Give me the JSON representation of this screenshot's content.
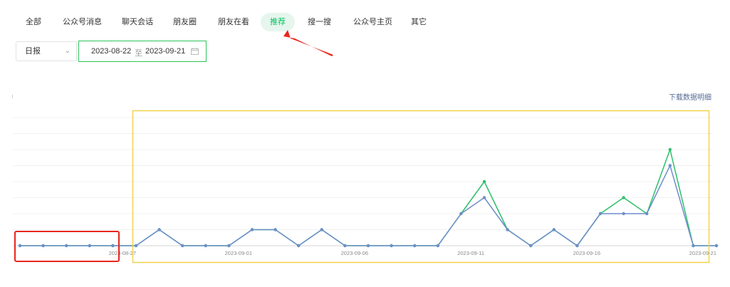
{
  "tabs": [
    {
      "label": "全部",
      "active": false
    },
    {
      "label": "公众号消息",
      "active": false
    },
    {
      "label": "聊天会话",
      "active": false
    },
    {
      "label": "朋友圈",
      "active": false
    },
    {
      "label": "朋友在看",
      "active": false
    },
    {
      "label": "推荐",
      "active": true
    },
    {
      "label": "搜一搜",
      "active": false
    },
    {
      "label": "公众号主页",
      "active": false
    },
    {
      "label": "其它",
      "active": false
    }
  ],
  "filters": {
    "frequency": "日报",
    "start_date": "2023-08-22",
    "separator": "至",
    "end_date": "2023-09-21",
    "calendar_icon": "calendar-icon",
    "dropdown_icon": "chevron-down-icon"
  },
  "download_label": "下载数据明细",
  "colors": {
    "accent": "#07c160",
    "series_green": "#2bc06c",
    "series_blue": "#6f8ecb",
    "highlight_yellow": "#f2d24c",
    "highlight_red": "#e8261d",
    "link": "#576b95"
  },
  "chart_data": {
    "type": "line",
    "x_tick_labels": [
      "2023-08-27",
      "2023-09-01",
      "2023-09-06",
      "2023-09-11",
      "2023-09-16",
      "2023-09-21"
    ],
    "x": [
      "2023-08-22",
      "2023-08-23",
      "2023-08-24",
      "2023-08-25",
      "2023-08-26",
      "2023-08-27",
      "2023-08-28",
      "2023-08-29",
      "2023-08-30",
      "2023-08-31",
      "2023-09-01",
      "2023-09-02",
      "2023-09-03",
      "2023-09-04",
      "2023-09-05",
      "2023-09-06",
      "2023-09-07",
      "2023-09-08",
      "2023-09-09",
      "2023-09-10",
      "2023-09-11",
      "2023-09-12",
      "2023-09-13",
      "2023-09-14",
      "2023-09-15",
      "2023-09-16",
      "2023-09-17",
      "2023-09-18",
      "2023-09-19",
      "2023-09-20",
      "2023-09-21"
    ],
    "series": [
      {
        "color": "#2bc06c",
        "values": [
          0,
          0,
          0,
          0,
          0,
          0,
          1,
          0,
          0,
          0,
          1,
          1,
          0,
          1,
          0,
          0,
          0,
          0,
          0,
          2,
          4,
          1,
          0,
          1,
          0,
          2,
          3,
          2,
          6,
          0,
          0
        ]
      },
      {
        "color": "#6f8ecb",
        "values": [
          0,
          0,
          0,
          0,
          0,
          0,
          1,
          0,
          0,
          0,
          1,
          1,
          0,
          1,
          0,
          0,
          0,
          0,
          0,
          2,
          3,
          1,
          0,
          1,
          0,
          2,
          2,
          2,
          5,
          0,
          0
        ]
      }
    ],
    "ylim": [
      0,
      8
    ],
    "grid": true
  }
}
